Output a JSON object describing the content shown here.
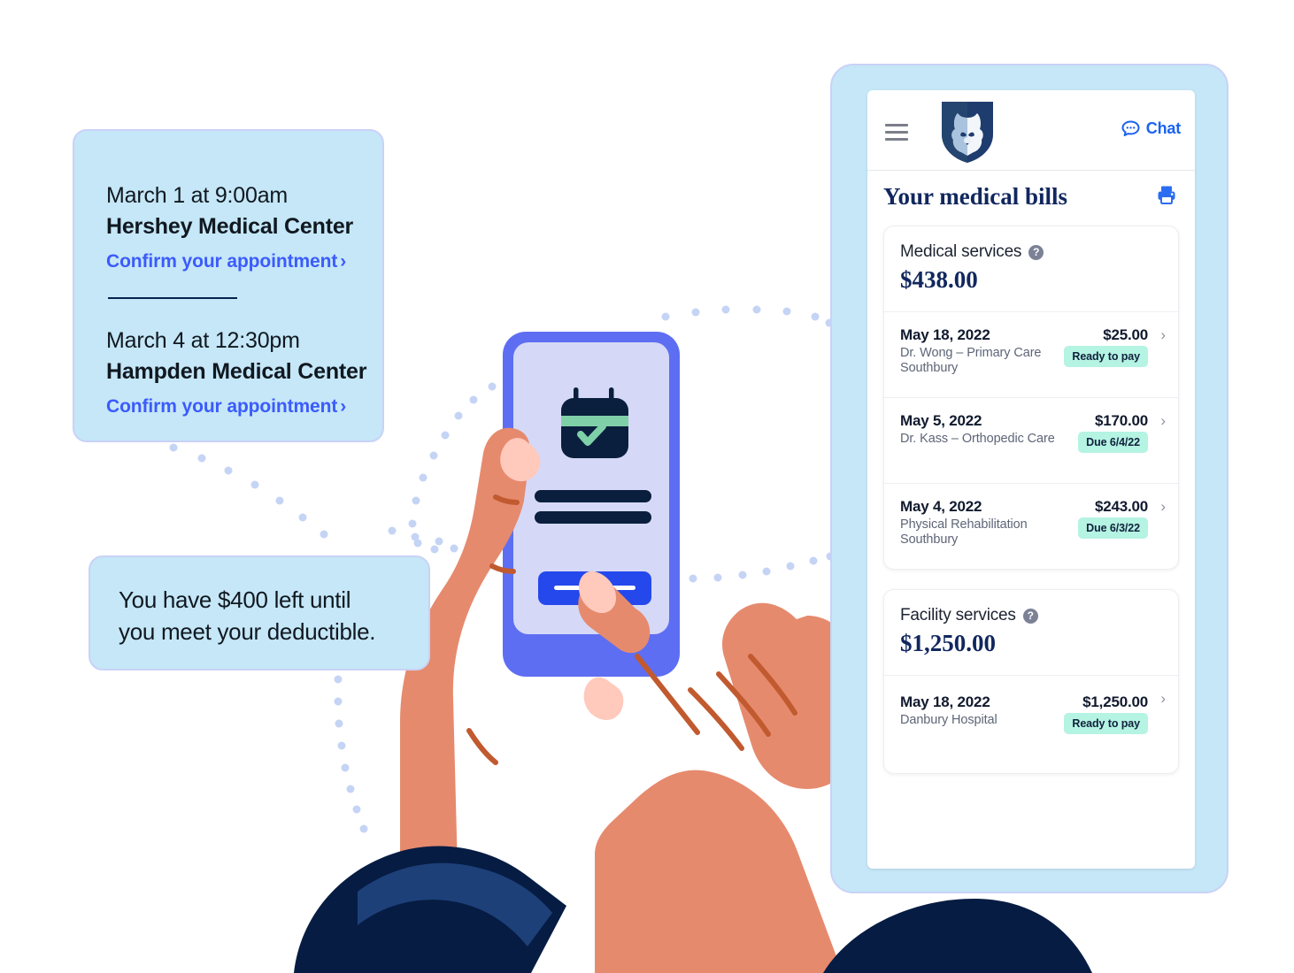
{
  "callouts": {
    "appointments": {
      "items": [
        {
          "time": "March 1 at 9:00am",
          "place": "Hershey Medical Center",
          "link": "Confirm your appointment",
          "chevron": "›"
        },
        {
          "time": "March 4 at 12:30pm",
          "place": "Hampden Medical Center",
          "link": "Confirm your appointment",
          "chevron": "›"
        }
      ]
    },
    "deductible": {
      "line1": "You have $400 left until",
      "line2": "you meet your deductible."
    }
  },
  "phone_app": {
    "header": {
      "menu_icon": "hamburger-icon",
      "logo_icon": "penn-state-nittany-lion-shield-logo",
      "chat_label": "Chat",
      "chat_icon": "chat-bubble-icon"
    },
    "page_title": "Your medical bills",
    "print_icon": "printer-icon",
    "groups": [
      {
        "label": "Medical services",
        "help_icon": "?",
        "total": "$438.00",
        "rows": [
          {
            "date": "May 18, 2022",
            "amount": "$25.00",
            "provider": "Dr. Wong – Primary Care Southbury",
            "badge": "Ready to pay",
            "chevron": "›"
          },
          {
            "date": "May 5, 2022",
            "amount": "$170.00",
            "provider": "Dr. Kass – Orthopedic Care",
            "badge": "Due 6/4/22",
            "chevron": "›"
          },
          {
            "date": "May 4, 2022",
            "amount": "$243.00",
            "provider": "Physical Rehabilitation Southbury",
            "badge": "Due 6/3/22",
            "chevron": "›"
          }
        ]
      },
      {
        "label": "Facility services",
        "help_icon": "?",
        "total": "$1,250.00",
        "rows": [
          {
            "date": "May 18, 2022",
            "amount": "$1,250.00",
            "provider": "Danbury Hospital",
            "badge": "Ready to pay",
            "chevron": "›"
          }
        ]
      }
    ]
  },
  "illustration": {
    "phone_screen_icons": {
      "calendar": "calendar-check-icon",
      "button": "submit-button"
    },
    "hands": "two-hands-holding-phone"
  },
  "colors": {
    "callout_bg": "#c5e7f7",
    "callout_border": "#c9d2f7",
    "link_blue": "#3b5bfd",
    "brand_navy": "#11275e",
    "badge_mint": "#b5f3e2",
    "dot_periwinkle": "#c5d4f5",
    "skin": "#e68a6e",
    "sleeve_navy": "#061c43",
    "phone_body_blue": "#5e6ef2",
    "phone_screen_lavender": "#d5d9f7",
    "calendar_navy": "#0a1f3d",
    "calendar_green": "#7fd0a8",
    "cta_blue": "#2448ec"
  }
}
